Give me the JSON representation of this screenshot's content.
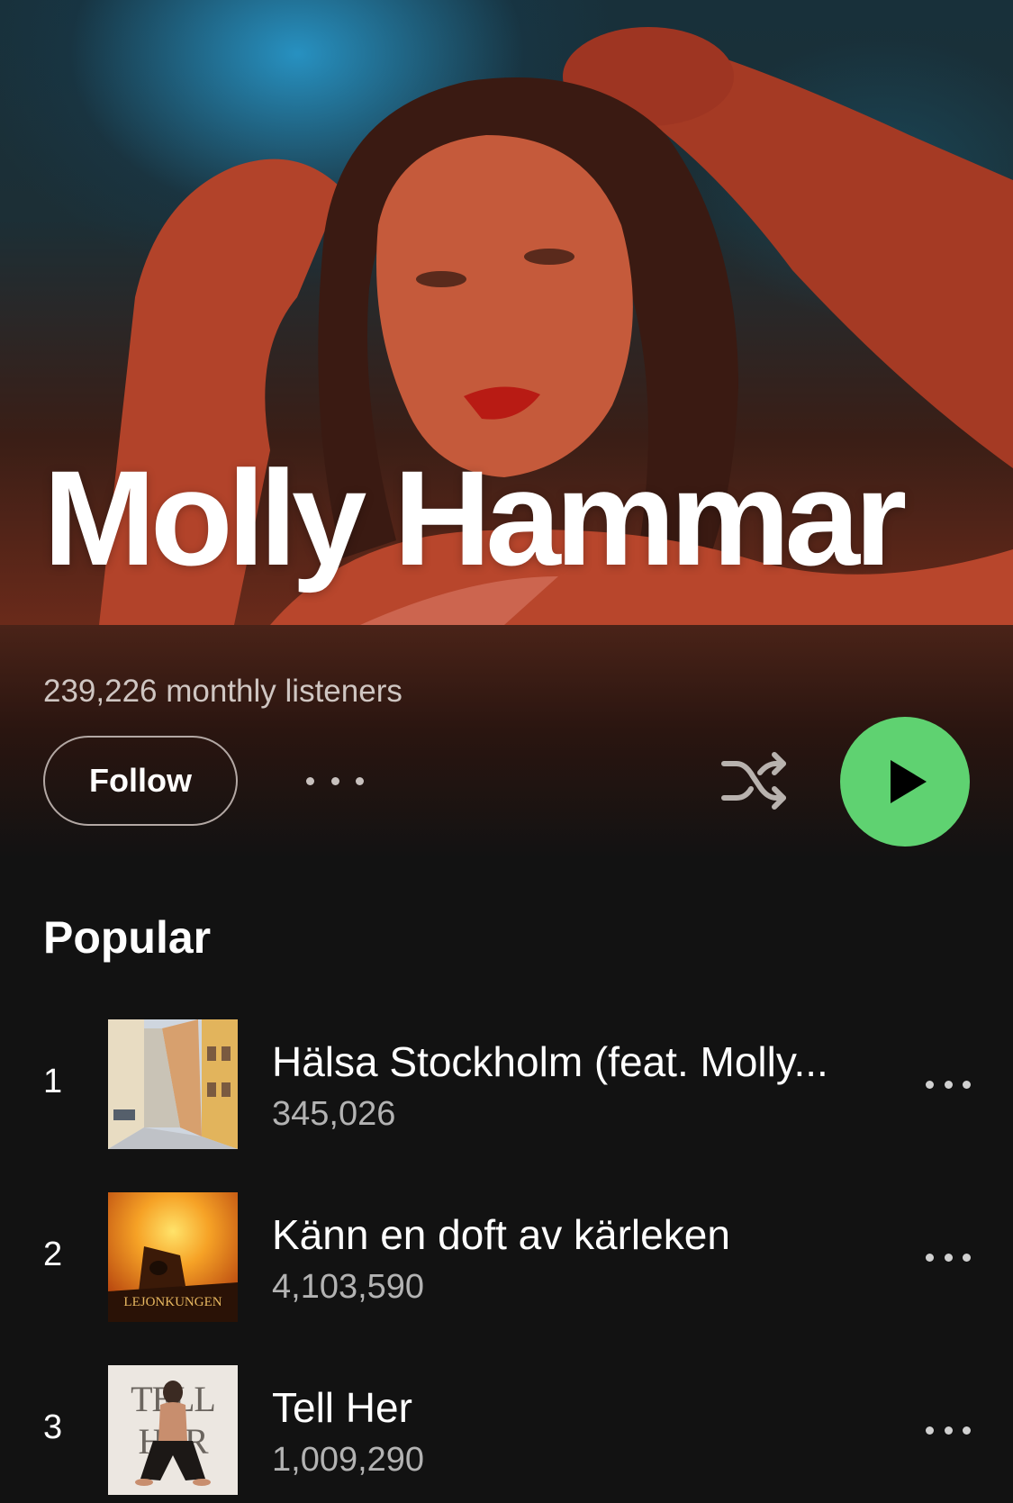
{
  "artist": {
    "name": "Molly Hammar",
    "monthly_listeners": "239,226 monthly listeners"
  },
  "actions": {
    "follow_label": "Follow",
    "more_icon": "more-horizontal-icon",
    "shuffle_icon": "shuffle-icon",
    "play_icon": "play-icon",
    "play_color": "#5fd271"
  },
  "popular": {
    "heading": "Popular",
    "tracks": [
      {
        "rank": "1",
        "title": "Hälsa Stockholm (feat. Molly...",
        "plays": "345,026"
      },
      {
        "rank": "2",
        "title": "Känn en doft av kärleken",
        "plays": "4,103,590",
        "cover_text": "LEJONKUNGEN"
      },
      {
        "rank": "3",
        "title": "Tell Her",
        "plays": "1,009,290",
        "cover_text": "TELL HER"
      }
    ]
  }
}
